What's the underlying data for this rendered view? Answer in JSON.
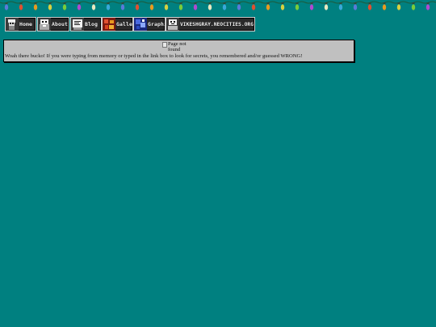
{
  "nav": {
    "buttons": [
      {
        "key": "home",
        "label": "Home",
        "icon": "home-icon"
      },
      {
        "key": "about",
        "label": "About",
        "icon": "about-icon"
      },
      {
        "key": "blog",
        "label": "Blog",
        "icon": "blog-icon"
      },
      {
        "key": "gallery",
        "label": "Gallery",
        "icon": "gallery-icon"
      },
      {
        "key": "graphics",
        "label": "Graphics",
        "icon": "graphics-icon"
      },
      {
        "key": "site",
        "label": "VIKESHGRAY.NEOCITIES.ORG",
        "icon": "site-icon"
      }
    ]
  },
  "content": {
    "image_alt": "Page not found",
    "message": "Woah there bucko! If you were typing from memory or typed in the link box to look for secrets, you remembered and/or guessed WRONG!"
  },
  "colors": {
    "background": "#008080",
    "panel": "#c0c0c0",
    "light_colors": [
      "#5a7ad8",
      "#e05030",
      "#e89a20",
      "#d8d040",
      "#7acb3a",
      "#b04ad0",
      "#e8e8c0",
      "#3aa8d8"
    ]
  }
}
